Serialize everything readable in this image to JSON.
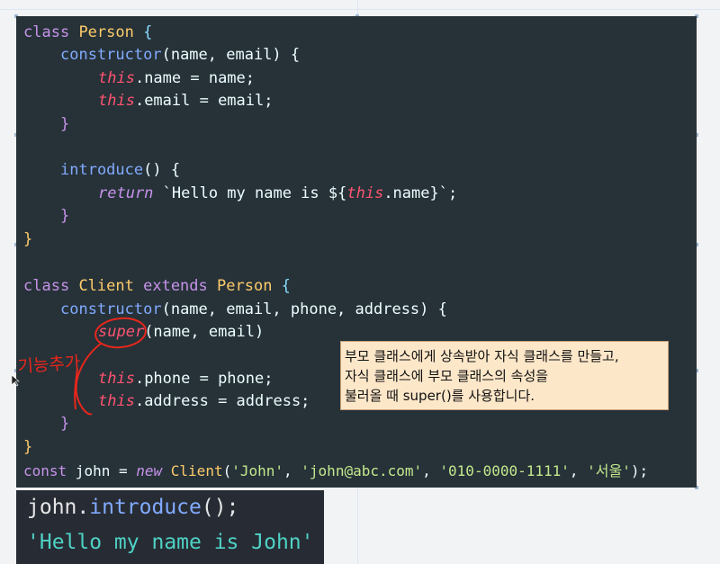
{
  "code": {
    "l1": [
      "class",
      " ",
      "Person",
      " {"
    ],
    "l2": [
      "constructor",
      "(name, email) {"
    ],
    "l3": [
      "this",
      ".name = name;"
    ],
    "l4": [
      "this",
      ".email = email;"
    ],
    "l5": [
      "}"
    ],
    "l7": [
      "introduce",
      "() {"
    ],
    "l8": [
      "return",
      " `Hello my name is ${",
      "this",
      ".name",
      "}`;"
    ],
    "l9": [
      "}"
    ],
    "l10": [
      "}"
    ],
    "l12": [
      "class",
      " ",
      "Client",
      " ",
      "extends",
      " ",
      "Person",
      " {"
    ],
    "l13": [
      "constructor",
      "(name, email, phone, address) {"
    ],
    "l14": [
      "super",
      "(name, email)"
    ],
    "l16": [
      "this",
      ".phone = phone;"
    ],
    "l17": [
      "this",
      ".address = address;"
    ],
    "l18": [
      "}"
    ],
    "l19": [
      "}"
    ],
    "l20": [
      "const",
      " john = ",
      "new",
      " ",
      "Client",
      "(",
      "'John'",
      ", ",
      "'john@abc.com'",
      ", ",
      "'010-0000-1111'",
      ", ",
      "'서울'",
      ");"
    ]
  },
  "console": {
    "call_obj": "john.",
    "call_fn": "introduce",
    "call_end": "();",
    "result": "'Hello my name is John'"
  },
  "note": {
    "line1": "부모 클래스에게 상속받아 자식 클래스를 만들고,",
    "line2": " 자식 클래스에 부모 클래스의 속성을",
    "line3": "불러올 때 super()를 사용합니다."
  },
  "annotation": {
    "handwritten": "기능추가"
  }
}
